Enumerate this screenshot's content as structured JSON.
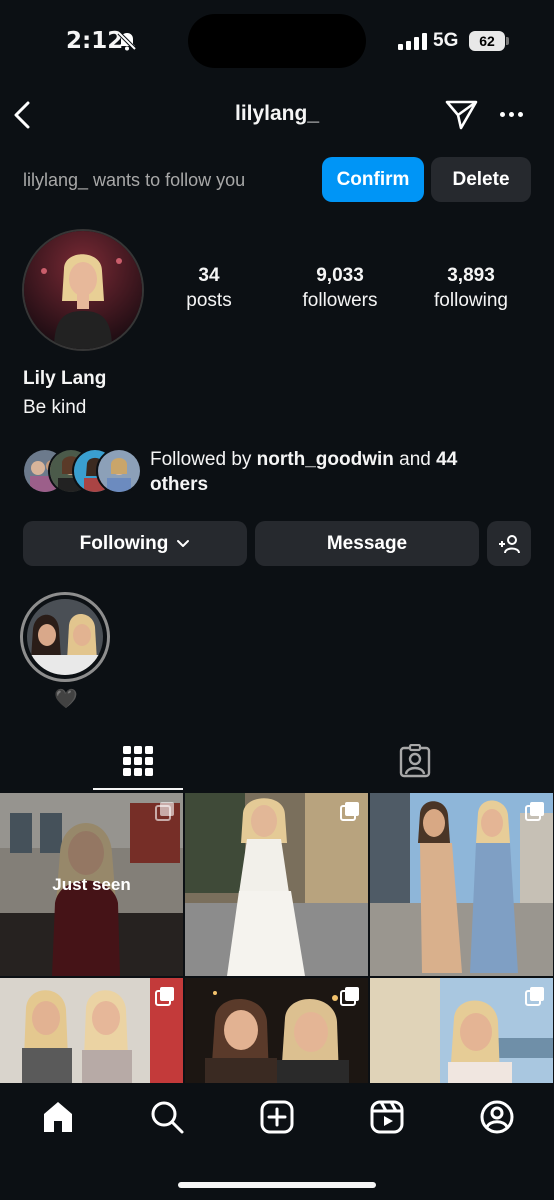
{
  "status_bar": {
    "time": "2:12",
    "network": "5G",
    "battery": "62"
  },
  "header": {
    "username": "lilylang_"
  },
  "follow_request": {
    "text": "lilylang_ wants to follow you",
    "confirm_label": "Confirm",
    "delete_label": "Delete"
  },
  "profile": {
    "posts_count": "34",
    "posts_label": "posts",
    "followers_count": "9,033",
    "followers_label": "followers",
    "following_count": "3,893",
    "following_label": "following",
    "name": "Lily Lang",
    "bio": "Be kind"
  },
  "followed_by": {
    "prefix": "Followed by ",
    "user": "north_goodwin",
    "middle": " and ",
    "count": "44",
    "suffix": "others"
  },
  "actions": {
    "following_label": "Following",
    "message_label": "Message"
  },
  "highlight": {
    "label": "🖤"
  },
  "grid": {
    "just_seen_label": "Just seen"
  },
  "colors": {
    "background": "#0c1014",
    "button": "#26292e",
    "accent": "#0095f6"
  },
  "icons": {
    "back": "chevron-left-icon",
    "send": "paper-plane-icon",
    "more": "more-horizontal-icon",
    "add_user": "add-user-icon",
    "grid_tab": "grid-icon",
    "tagged_tab": "tagged-person-icon",
    "nav": [
      "home-icon",
      "search-icon",
      "create-icon",
      "reels-icon",
      "profile-icon"
    ]
  }
}
